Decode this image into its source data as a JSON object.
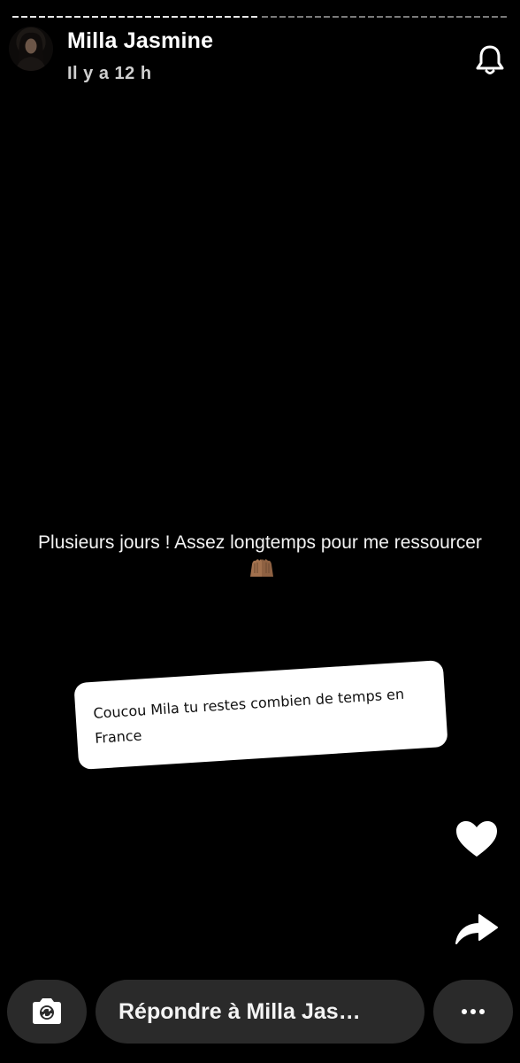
{
  "story": {
    "progress": {
      "segments": 2,
      "viewed": 1
    },
    "user_name": "Milla Jasmine",
    "timestamp": "Il y a 12 h",
    "caption": "Plusieurs jours ! Assez longtemps pour me ressourcer",
    "caption_emoji": "praying-hands-emoji",
    "question_text": "Coucou Mila tu restes combien de temps en France"
  },
  "actions": {
    "notify_icon": "bell-icon",
    "like_icon": "heart-icon",
    "share_icon": "share-arrow-icon"
  },
  "bottom_bar": {
    "camera_icon": "camera-icon",
    "reply_label": "Répondre à Milla Jas…",
    "more_icon": "more-dots-icon"
  },
  "colors": {
    "background": "#000000",
    "bar_button": "#2a2a2a",
    "card": "#ffffff"
  }
}
